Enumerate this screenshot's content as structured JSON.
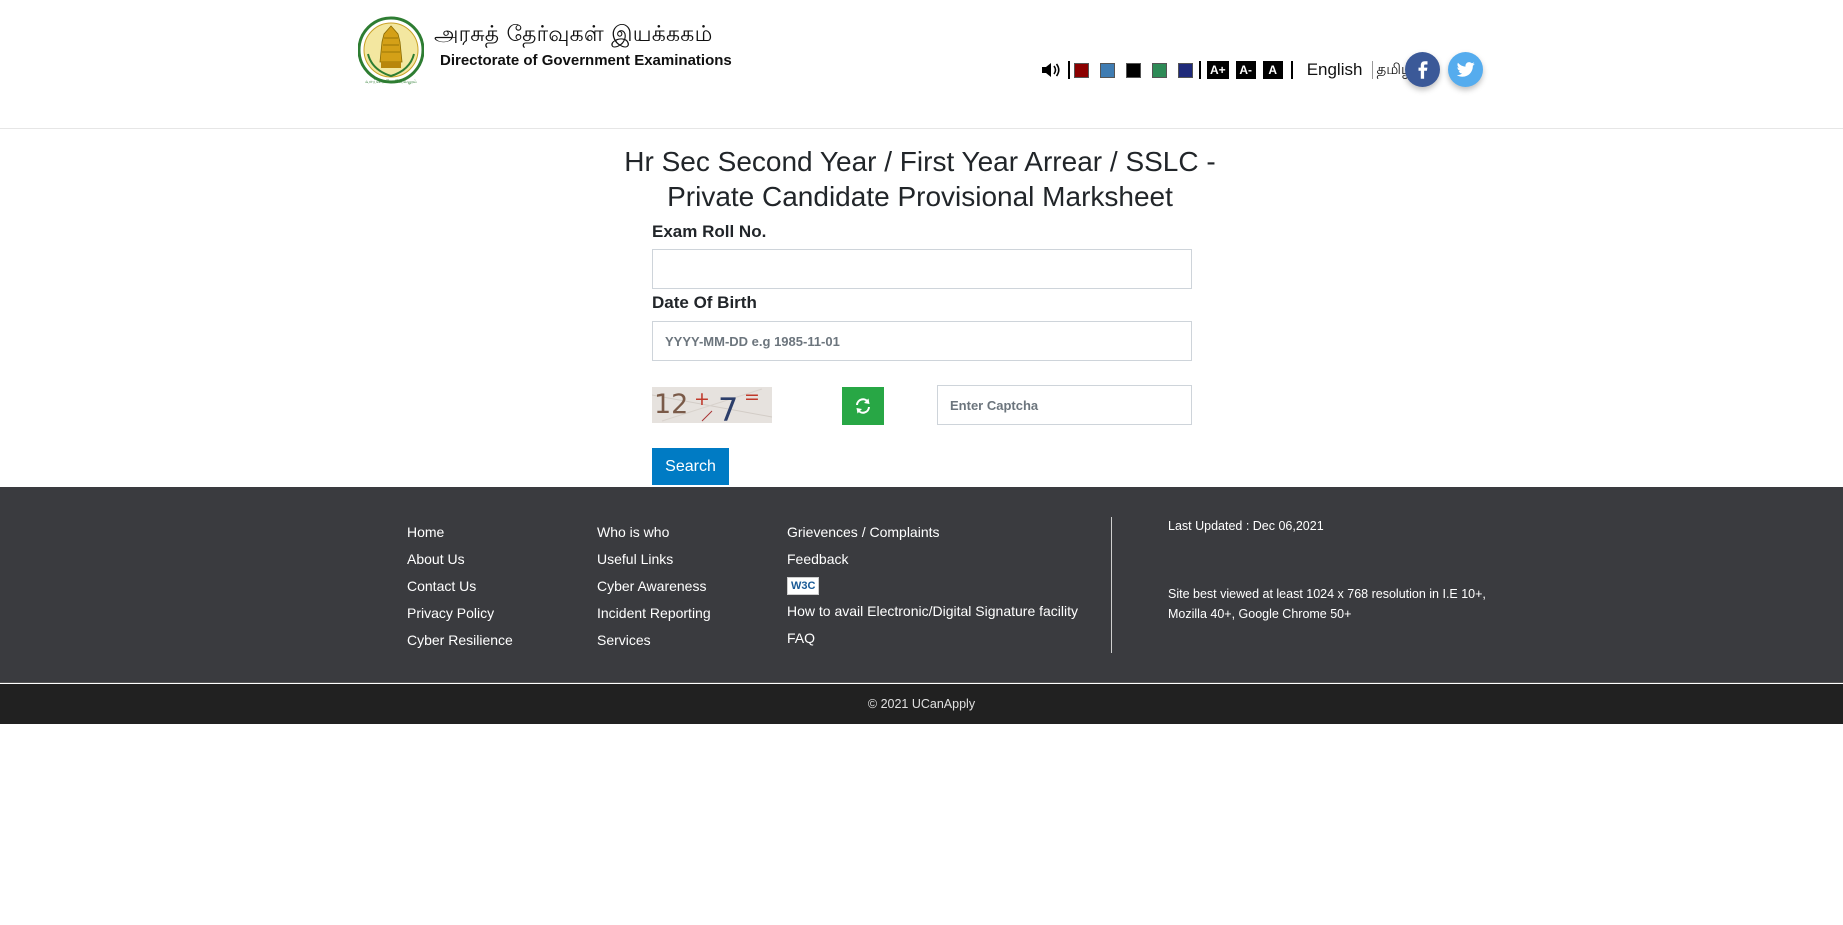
{
  "header": {
    "brand_tamil": "அரசுத் தேர்வுகள் இயக்ககம்",
    "brand_english": "Directorate of Government Examinations",
    "emblem_icon": "tn-government-emblem-icon",
    "color_swatches": [
      "#8b0000",
      "#3f7cb2",
      "#000000",
      "#2e8b57",
      "#1f2a7a"
    ],
    "font_buttons": [
      "A+",
      "A-",
      "A"
    ],
    "language_english": "English",
    "language_tamil": "தமிழ்",
    "social": {
      "facebook_icon": "facebook-icon",
      "twitter_icon": "twitter-icon"
    }
  },
  "form": {
    "title_line1": "Hr Sec Second Year / First Year Arrear / SSLC -",
    "title_line2": "Private Candidate Provisional Marksheet",
    "roll_label": "Exam Roll No.",
    "roll_value": "",
    "dob_label": "Date Of Birth",
    "dob_placeholder": "YYYY-MM-DD e.g 1985-11-01",
    "captcha_text": "12 + 7 =",
    "captcha_placeholder": "Enter Captcha",
    "search_label": "Search"
  },
  "footer": {
    "col1": [
      "Home",
      "About Us",
      "Contact Us",
      "Privacy Policy",
      "Cyber Resilience"
    ],
    "col2": [
      "Who is who",
      "Useful Links",
      "Cyber Awareness",
      "Incident Reporting",
      "Services"
    ],
    "col3_top": [
      "Grievences / Complaints",
      "Feedback"
    ],
    "w3c_label": "W3C",
    "col3_bottom": [
      "How to avail Electronic/Digital Signature facility",
      "FAQ"
    ],
    "last_updated": "Last Updated : Dec 06,2021",
    "best_viewed": "Site best viewed at least 1024 x 768 resolution in I.E 10+, Mozilla 40+, Google Chrome 50+",
    "copyright": "© 2021 UCanApply"
  }
}
